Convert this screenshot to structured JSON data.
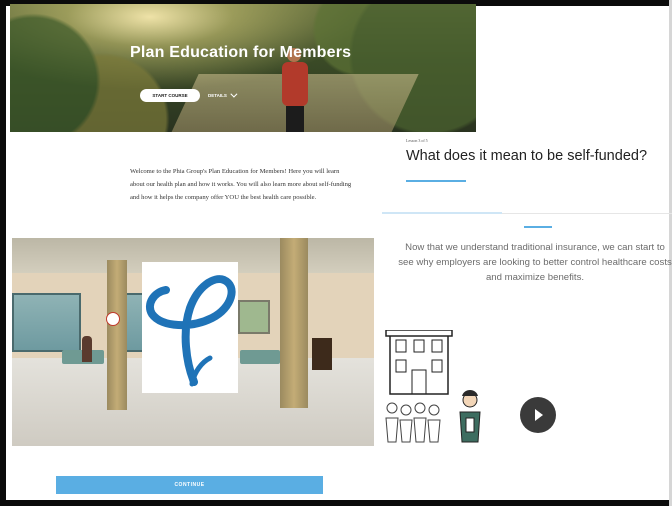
{
  "course": {
    "title": "Plan Education for Members",
    "start_label": "START COURSE",
    "details_label": "DETAILS",
    "welcome_text": "Welcome to the Phia Group's Plan Education for Members! Here you will learn about our health plan and how it works. You will also learn more about self-funding and how it helps the company offer YOU the best health care possible.",
    "continue_label": "CONTINUE"
  },
  "lesson": {
    "counter": "Lesson 3 of 5",
    "title": "What does it mean to be self-funded?",
    "body": "Now that we understand traditional insurance, we can start to see why employers are looking to better control healthcare costs and maximize benefits."
  },
  "colors": {
    "accent": "#5aaee3",
    "logo_blue": "#1f73b7",
    "play_button": "#3a3a3a"
  },
  "icons": [
    "chevron-down-icon",
    "play-icon",
    "phia-logo"
  ]
}
